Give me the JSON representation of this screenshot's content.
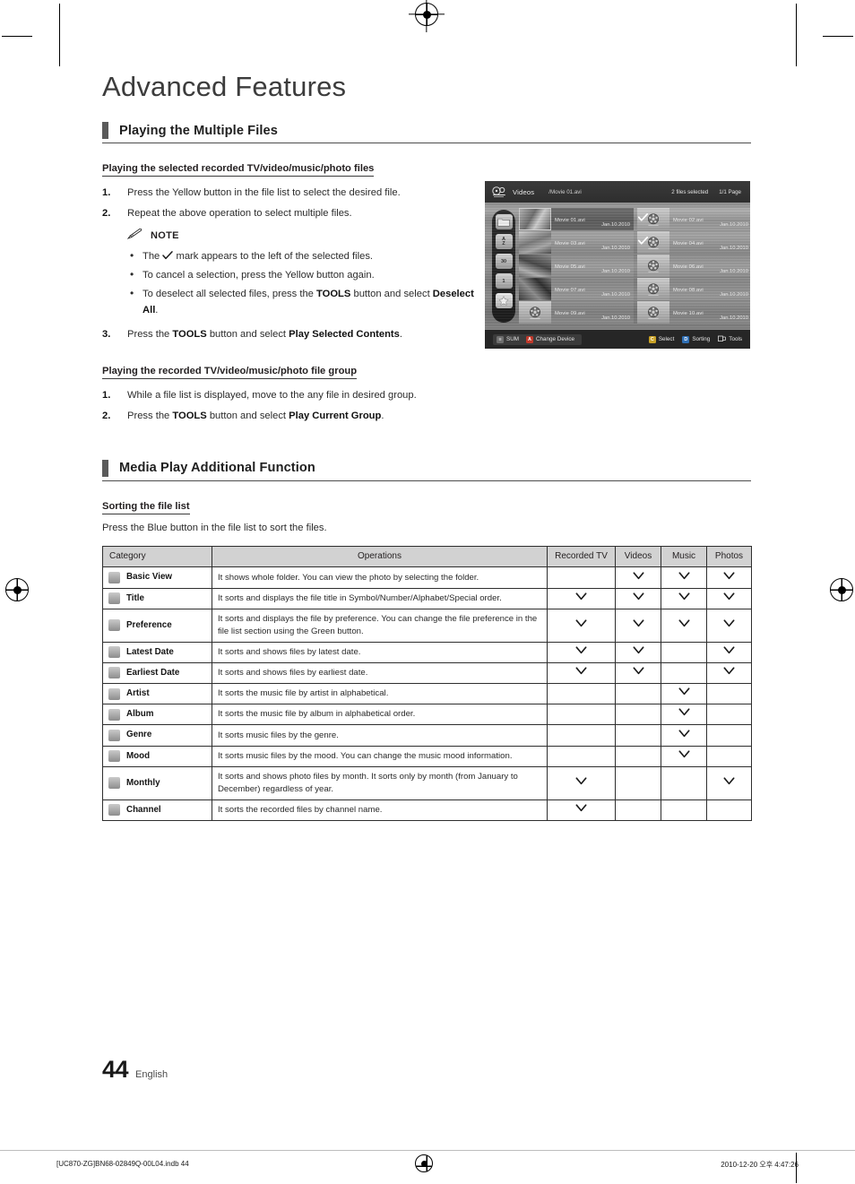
{
  "page": {
    "chapter_title": "Advanced Features",
    "page_number": "44",
    "language": "English",
    "print_footer_left": "[UC870-ZG]BN68-02849Q-00L04.indb   44",
    "print_footer_right": "2010-12-20   오후 4:47:26"
  },
  "section1": {
    "heading": "Playing the Multiple Files",
    "sub1": {
      "heading": "Playing the selected recorded TV/video/music/photo files",
      "steps": [
        {
          "num": "1.",
          "text": "Press the Yellow button in the file list to select the desired file."
        },
        {
          "num": "2.",
          "text": "Repeat the above operation to select multiple files."
        }
      ],
      "note": {
        "label": "NOTE",
        "items": [
          {
            "pre": "The ",
            "check": true,
            "post": " mark appears to the left of the selected files."
          },
          {
            "pre": "To cancel a selection, press the Yellow button again.",
            "check": false,
            "post": ""
          },
          {
            "pre": "To deselect all selected files, press the ",
            "bold1": "TOOLS",
            "mid": " button and select ",
            "bold2": "Deselect All",
            "post": ".",
            "check": false
          }
        ]
      },
      "step3": {
        "num": "3.",
        "pre": "Press the ",
        "bold1": "TOOLS",
        "mid": " button and select ",
        "bold2": "Play Selected Contents",
        "post": "."
      }
    },
    "sub2": {
      "heading": "Playing the recorded TV/video/music/photo file group",
      "steps": [
        {
          "num": "1.",
          "text": "While a file list is displayed, move to the any file in desired group."
        }
      ],
      "step2": {
        "num": "2.",
        "pre": "Press the ",
        "bold1": "TOOLS",
        "mid": " button and select ",
        "bold2": "Play Current Group",
        "post": "."
      }
    }
  },
  "tv_screenshot": {
    "header": {
      "logo_icon": "videos-reel-icon",
      "section": "Videos",
      "path": "/Movie 01.avi",
      "selected_count": "2 files selected",
      "page_indicator": "1/1 Page"
    },
    "rail_icons": [
      {
        "name": "folder-icon",
        "label": ""
      },
      {
        "name": "title-az-icon",
        "label": "A\nZ"
      },
      {
        "name": "calendar-30-icon",
        "label": "30"
      },
      {
        "name": "calendar-1-icon",
        "label": "1"
      },
      {
        "name": "star-preference-icon",
        "label": "★"
      }
    ],
    "files_left": [
      {
        "name": "Movie 01.avi",
        "date": "Jan.10.2010",
        "selected": true,
        "checked": false,
        "thumb": "photo1"
      },
      {
        "name": "Movie 03.avi",
        "date": "Jan.10.2010",
        "selected": false,
        "checked": false,
        "thumb": "photo2"
      },
      {
        "name": "Movie 05.avi",
        "date": "Jan.10.2010",
        "selected": false,
        "checked": false,
        "thumb": "photo3"
      },
      {
        "name": "Movie 07.avi",
        "date": "Jan.10.2010",
        "selected": false,
        "checked": false,
        "thumb": "photo4"
      },
      {
        "name": "Movie 09.avi",
        "date": "Jan.10.2010",
        "selected": false,
        "checked": false,
        "thumb": "reel"
      }
    ],
    "files_right": [
      {
        "name": "Movie 02.avi",
        "date": "Jan.10.2010",
        "selected": false,
        "checked": true,
        "thumb": "reel"
      },
      {
        "name": "Movie 04.avi",
        "date": "Jan.10.2010",
        "selected": false,
        "checked": true,
        "thumb": "reel"
      },
      {
        "name": "Movie 06.avi",
        "date": "Jan.10.2010",
        "selected": false,
        "checked": false,
        "thumb": "reel"
      },
      {
        "name": "Movie 08.avi",
        "date": "Jan.10.2010",
        "selected": false,
        "checked": false,
        "thumb": "reel"
      },
      {
        "name": "Movie 10.avi",
        "date": "Jan.10.2010",
        "selected": false,
        "checked": false,
        "thumb": "reel"
      }
    ],
    "footer": {
      "sum_label": "SUM",
      "change_device_key": "A",
      "change_device_label": "Change Device",
      "select_key": "C",
      "select_label": "Select",
      "sorting_key": "D",
      "sorting_label": "Sorting",
      "tools_label": "Tools"
    }
  },
  "section2": {
    "heading": "Media Play Additional Function",
    "sub_heading": "Sorting the file list",
    "intro": "Press the Blue button in the file list to sort the files.",
    "table": {
      "headers": [
        "Category",
        "Operations",
        "Recorded TV",
        "Videos",
        "Music",
        "Photos"
      ],
      "rows": [
        {
          "icon": "folder-icon",
          "category": "Basic View",
          "operations": "It shows whole folder. You can view the photo by selecting the folder.",
          "marks": [
            false,
            true,
            true,
            true
          ]
        },
        {
          "icon": "title-az-icon",
          "category": "Title",
          "operations": "It sorts and displays the file title in Symbol/Number/Alphabet/Special order.",
          "marks": [
            true,
            true,
            true,
            true
          ]
        },
        {
          "icon": "star-preference-icon",
          "category": "Preference",
          "operations": "It sorts and displays the file by preference. You can change the file preference in the file list section using the Green button.",
          "marks": [
            true,
            true,
            true,
            true
          ]
        },
        {
          "icon": "calendar-30-icon",
          "category": "Latest Date",
          "operations": "It sorts and shows files by latest date.",
          "marks": [
            true,
            true,
            false,
            true
          ]
        },
        {
          "icon": "calendar-1-icon",
          "category": "Earliest Date",
          "operations": "It sorts and shows files by earliest date.",
          "marks": [
            true,
            true,
            false,
            true
          ]
        },
        {
          "icon": "artist-person-icon",
          "category": "Artist",
          "operations": "It sorts the music file by artist in alphabetical.",
          "marks": [
            false,
            false,
            true,
            false
          ]
        },
        {
          "icon": "album-disc-icon",
          "category": "Album",
          "operations": "It sorts the music file by album in alphabetical order.",
          "marks": [
            false,
            false,
            true,
            false
          ]
        },
        {
          "icon": "genre-note-icon",
          "category": "Genre",
          "operations": "It sorts music files by the genre.",
          "marks": [
            false,
            false,
            true,
            false
          ]
        },
        {
          "icon": "mood-icon",
          "category": "Mood",
          "operations": "It sorts music files by the mood. You can change the music mood information.",
          "marks": [
            false,
            false,
            true,
            false
          ]
        },
        {
          "icon": "monthly-calendar-icon",
          "category": "Monthly",
          "operations": "It sorts and shows photo files by month. It sorts only by month (from January to December) regardless of year.",
          "marks": [
            true,
            false,
            false,
            true
          ]
        },
        {
          "icon": "channel-icon",
          "category": "Channel",
          "operations": "It sorts the recorded files by channel name.",
          "marks": [
            true,
            false,
            false,
            false
          ]
        }
      ]
    }
  }
}
